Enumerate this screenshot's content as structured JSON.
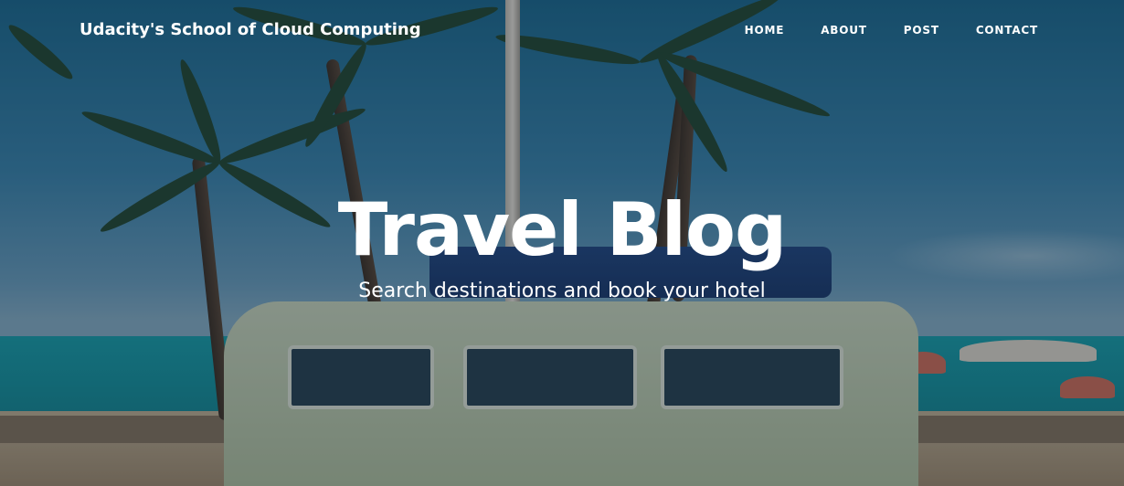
{
  "header": {
    "brand": "Udacity's School of Cloud Computing",
    "nav": [
      {
        "label": "HOME"
      },
      {
        "label": "ABOUT"
      },
      {
        "label": "POST"
      },
      {
        "label": "CONTACT"
      }
    ]
  },
  "hero": {
    "title": "Travel Blog",
    "subtitle": "Search destinations and book your hotel",
    "background_image": "beach-van-palm-trees-photo"
  },
  "colors": {
    "text": "#ffffff",
    "overlay": "#0a1423"
  }
}
